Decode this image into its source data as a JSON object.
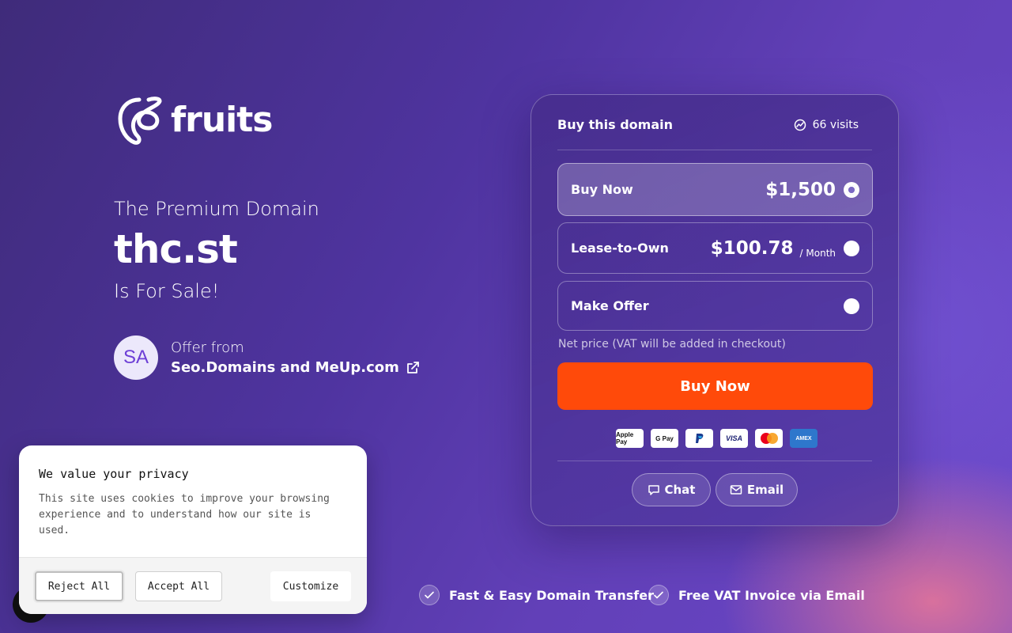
{
  "brand": {
    "name": "fruits"
  },
  "hero": {
    "premium": "The Premium Domain",
    "domain": "thc.st",
    "for_sale": "Is For Sale!"
  },
  "seller": {
    "initials": "SA",
    "offer_from": "Offer from",
    "name": "Seo.Domains and MeUp.com"
  },
  "card": {
    "title": "Buy this domain",
    "visits": "66 visits",
    "options": [
      {
        "label": "Buy Now",
        "price": "$1,500",
        "unit": "",
        "selected": true
      },
      {
        "label": "Lease-to-Own",
        "price": "$100.78",
        "unit": "/ Month",
        "selected": false
      },
      {
        "label": "Make Offer",
        "price": "",
        "unit": "",
        "selected": false
      }
    ],
    "net_price_note": "Net price (VAT will be added in checkout)",
    "buy_button": "Buy Now",
    "payment_methods": [
      "Apple Pay",
      "G Pay",
      "PayPal",
      "VISA",
      "Mastercard",
      "AMEX"
    ],
    "chat_button": "Chat",
    "email_button": "Email"
  },
  "features": [
    "Fast & Easy Domain Transfer",
    "Free VAT Invoice via Email"
  ],
  "cookie": {
    "title": "We value your privacy",
    "text": "This site uses cookies to improve your browsing experience and to understand how our site is used.",
    "reject": "Reject All",
    "accept": "Accept All",
    "customize": "Customize"
  },
  "colors": {
    "accent": "#ff4a0a",
    "bg_start": "#3f2b7a",
    "bg_end": "#6a47c8"
  }
}
